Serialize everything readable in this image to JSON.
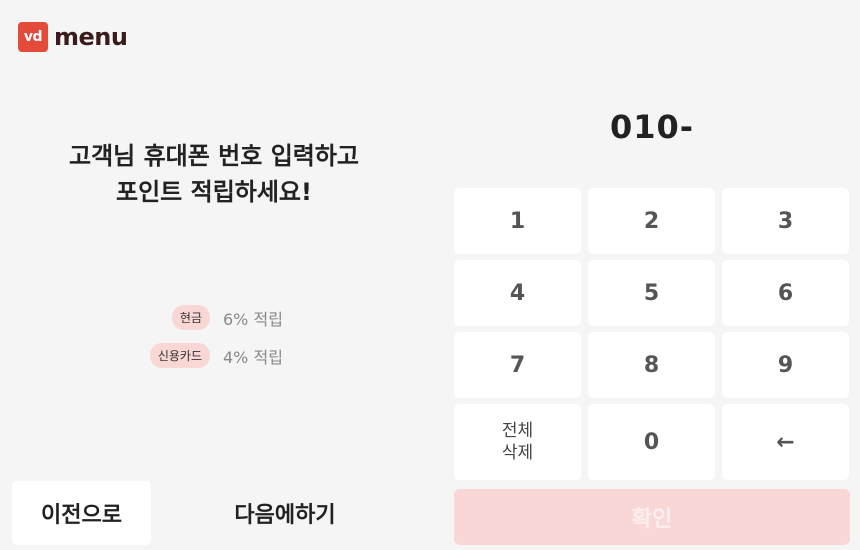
{
  "logo": {
    "badge": "vd",
    "word": "menu"
  },
  "headline": {
    "line1": "고객님 휴대폰 번호 입력하고",
    "line2": "포인트 적립하세요!"
  },
  "rewards": [
    {
      "tag": "현금",
      "rate": "6% 적립"
    },
    {
      "tag": "신용카드",
      "rate": "4% 적립"
    }
  ],
  "phone": {
    "value": "010-"
  },
  "keypad": {
    "keys": [
      "1",
      "2",
      "3",
      "4",
      "5",
      "6",
      "7",
      "8",
      "9"
    ],
    "clear_line1": "전체",
    "clear_line2": "삭제",
    "zero": "0",
    "backspace": "←"
  },
  "confirm_label": "확인",
  "prev_label": "이전으로",
  "later_label": "다음에하기",
  "colors": {
    "brand": "#e44b3a",
    "confirm_bg": "#f9d7d7",
    "tag_bg": "#f9d7d4"
  }
}
